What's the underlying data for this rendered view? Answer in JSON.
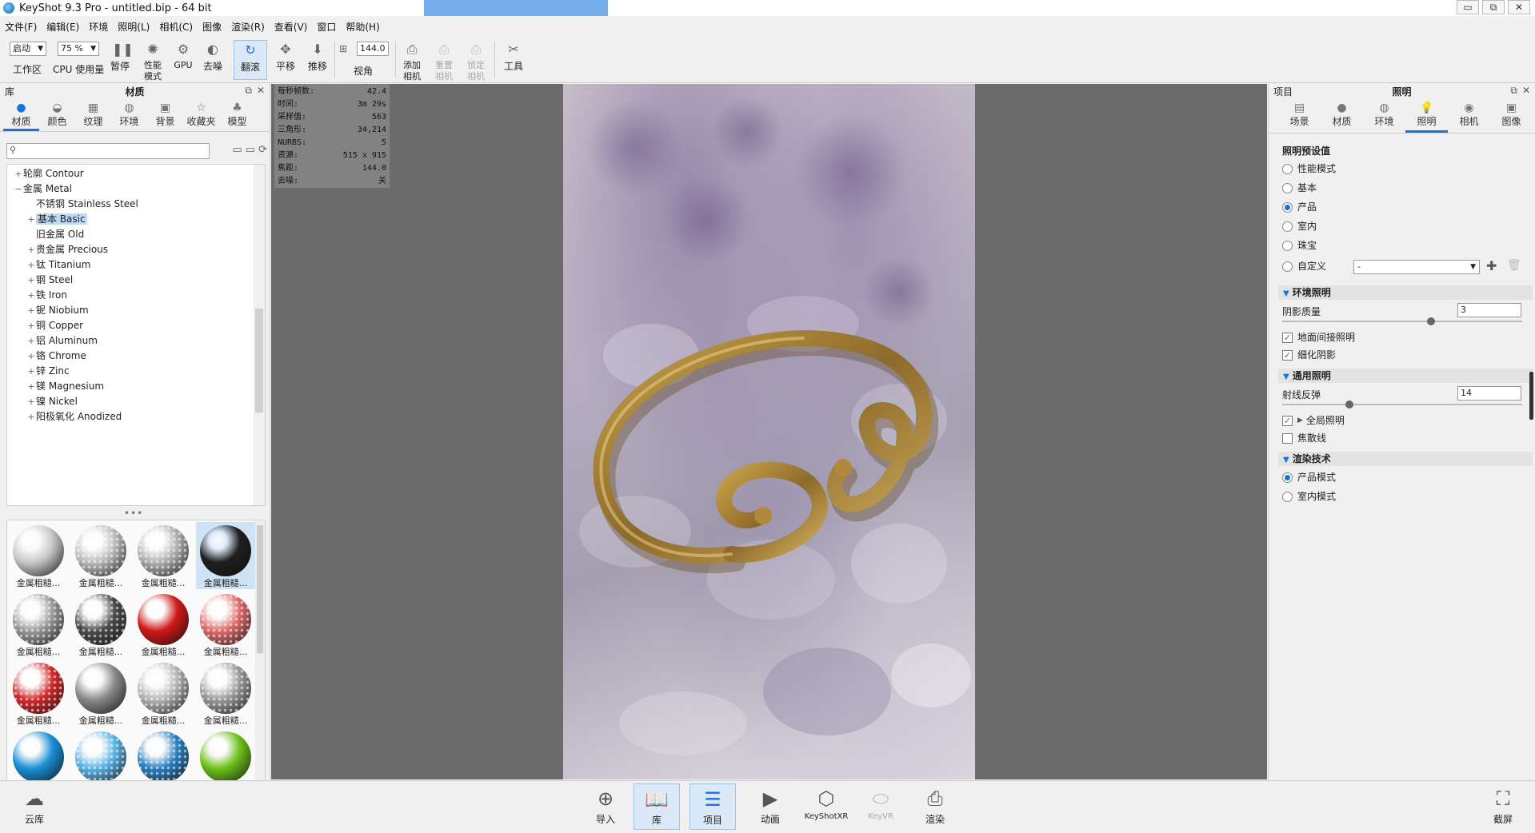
{
  "window": {
    "title": "KeyShot 9.3 Pro  - untitled.bip  - 64 bit",
    "controls": [
      "▭",
      "⧉",
      "✕"
    ]
  },
  "menu": [
    "文件(F)",
    "编辑(E)",
    "环境",
    "照明(L)",
    "相机(C)",
    "图像",
    "渲染(R)",
    "查看(V)",
    "窗口",
    "帮助(H)"
  ],
  "toolbar": {
    "workspace_select": "启动",
    "workspace_label": "工作区",
    "cpu_select": "75 %",
    "cpu_label": "CPU 使用量",
    "pause_label": "暂停",
    "perf_label": "性能\n模式",
    "gpu_label": "GPU",
    "denoise_label": "去噪",
    "tumble_label": "翻滚",
    "pan_label": "平移",
    "dolly_label": "推移",
    "fov_value": "144.0",
    "fov_label": "视角",
    "add_camera_label": "添加\n相机",
    "reset_camera_label": "重置\n相机",
    "lock_camera_label": "锁定\n相机",
    "tools_label": "工具"
  },
  "library": {
    "header_left": "库",
    "header_title": "材质",
    "tabs": [
      {
        "label": "材质",
        "icon": "ball-icon"
      },
      {
        "label": "颜色",
        "icon": "palette-icon"
      },
      {
        "label": "纹理",
        "icon": "texture-icon"
      },
      {
        "label": "环境",
        "icon": "globe-icon"
      },
      {
        "label": "背景",
        "icon": "image-icon"
      },
      {
        "label": "收藏夹",
        "icon": "star-icon"
      },
      {
        "label": "模型",
        "icon": "model-icon"
      }
    ],
    "search_placeholder": "",
    "tree": [
      {
        "exp": "+",
        "label": "轮廓 Contour",
        "level": 0
      },
      {
        "exp": "−",
        "label": "金属 Metal",
        "level": 0
      },
      {
        "exp": "",
        "label": "不锈钢 Stainless Steel",
        "level": 1
      },
      {
        "exp": "+",
        "label": "基本 Basic",
        "level": 1,
        "selected": true
      },
      {
        "exp": "",
        "label": "旧金属 Old",
        "level": 1
      },
      {
        "exp": "+",
        "label": "贵金属 Precious",
        "level": 1
      },
      {
        "exp": "+",
        "label": "钛 Titanium",
        "level": 1
      },
      {
        "exp": "+",
        "label": "钢 Steel",
        "level": 1
      },
      {
        "exp": "+",
        "label": "铁 Iron",
        "level": 1
      },
      {
        "exp": "+",
        "label": "铌 Niobium",
        "level": 1
      },
      {
        "exp": "+",
        "label": "铜 Copper",
        "level": 1
      },
      {
        "exp": "+",
        "label": "铝 Aluminum",
        "level": 1
      },
      {
        "exp": "+",
        "label": "铬 Chrome",
        "level": 1
      },
      {
        "exp": "+",
        "label": "锌 Zinc",
        "level": 1
      },
      {
        "exp": "+",
        "label": "镁 Magnesium",
        "level": 1
      },
      {
        "exp": "+",
        "label": "镍 Nickel",
        "level": 1
      },
      {
        "exp": "+",
        "label": "阳极氧化 Anodized",
        "level": 1
      }
    ],
    "thumb_caption": "金属粗糙...",
    "thumbs": [
      {
        "color": "#c8c8c8",
        "style": "smooth"
      },
      {
        "color": "#bdbdbd",
        "style": "dots"
      },
      {
        "color": "#b0b0b0",
        "style": "dots"
      },
      {
        "color": "#1e1e1e",
        "style": "smooth",
        "selected": true
      },
      {
        "color": "#9a9a9a",
        "style": "dots"
      },
      {
        "color": "#4a4a4a",
        "style": "dots"
      },
      {
        "color": "#d01818",
        "style": "smooth"
      },
      {
        "color": "#e06a6a",
        "style": "dots"
      },
      {
        "color": "#d42a2a",
        "style": "dots"
      },
      {
        "color": "#8a8a8a",
        "style": "smooth"
      },
      {
        "color": "#b5b5b5",
        "style": "dots"
      },
      {
        "color": "#9a9a9a",
        "style": "dots"
      },
      {
        "color": "#1a8fd6",
        "style": "smooth"
      },
      {
        "color": "#5ab3e8",
        "style": "dots"
      },
      {
        "color": "#2a7fc0",
        "style": "dots"
      },
      {
        "color": "#6cc21a",
        "style": "smooth"
      },
      {
        "color": "#8cd04a",
        "style": "dots"
      },
      {
        "color": "#7ac83a",
        "style": "dots"
      },
      {
        "color": "#b0b0b0",
        "style": "smooth"
      },
      {
        "color": "#c0c0c0",
        "style": "smooth"
      }
    ]
  },
  "stats": [
    {
      "label": "每秒帧数:",
      "value": "42.4"
    },
    {
      "label": "时间:",
      "value": "3m 29s"
    },
    {
      "label": "采样值:",
      "value": "563"
    },
    {
      "label": "三角形:",
      "value": "34,214"
    },
    {
      "label": "NURBS:",
      "value": "5"
    },
    {
      "label": "资源:",
      "value": "515 x 915"
    },
    {
      "label": "焦距:",
      "value": "144.0"
    },
    {
      "label": "去噪:",
      "value": "关"
    }
  ],
  "project": {
    "header_left": "项目",
    "header_title": "照明",
    "tabs": [
      {
        "label": "场景",
        "icon": "scene-icon"
      },
      {
        "label": "材质",
        "icon": "ball-icon"
      },
      {
        "label": "环境",
        "icon": "globe-icon"
      },
      {
        "label": "照明",
        "icon": "bulb-icon"
      },
      {
        "label": "相机",
        "icon": "camera-icon"
      },
      {
        "label": "图像",
        "icon": "image-icon"
      }
    ],
    "preset_title": "照明预设值",
    "presets": [
      {
        "label": "性能模式",
        "checked": false
      },
      {
        "label": "基本",
        "checked": false
      },
      {
        "label": "产品",
        "checked": true
      },
      {
        "label": "室内",
        "checked": false
      },
      {
        "label": "珠宝",
        "checked": false
      },
      {
        "label": "自定义",
        "checked": false
      }
    ],
    "custom_select": "-",
    "env_lighting": {
      "title": "环境照明",
      "shadow_quality_label": "阴影质量",
      "shadow_quality_value": "3",
      "shadow_quality_level": 0.62,
      "ground_indirect_label": "地面间接照明",
      "refine_shadows_label": "细化阴影"
    },
    "general_lighting": {
      "title": "通用照明",
      "ray_bounces_label": "射线反弹",
      "ray_bounces_value": "14",
      "ray_bounces_level": 0.28,
      "global_illumination_label": "全局照明",
      "caustics_label": "焦散线"
    },
    "render_technique": {
      "title": "渲染技术",
      "options": [
        {
          "label": "产品模式",
          "checked": true
        },
        {
          "label": "室内模式",
          "checked": false
        }
      ]
    }
  },
  "bottom": {
    "cloud_label": "云库",
    "import_label": "导入",
    "library_label": "库",
    "project_label": "项目",
    "animation_label": "动画",
    "keyshotxr_label": "KeyShotXR",
    "keyvr_label": "KeyVR",
    "render_label": "渲染",
    "screenshot_label": "截屏"
  }
}
